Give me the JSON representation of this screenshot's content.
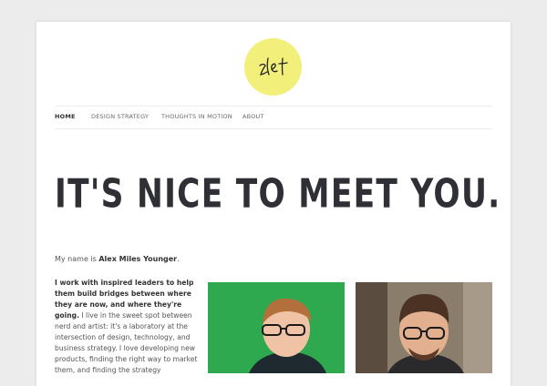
{
  "logo": {
    "text": "zle+",
    "color": "#f2f07a"
  },
  "nav": {
    "items": [
      {
        "label": "HOME",
        "active": true
      },
      {
        "label": "DESIGN STRATEGY",
        "active": false
      },
      {
        "label": "THOUGHTS IN MOTION",
        "active": false
      },
      {
        "label": "ABOUT",
        "active": false
      }
    ]
  },
  "hero": {
    "headline": "IT'S NICE TO MEET YOU."
  },
  "intro": {
    "prefix": "My name is ",
    "name": "Alex Miles Younger",
    "suffix": "."
  },
  "body": {
    "bold_text": "I work with inspired leaders to help them build bridges between where they are now, and where they're going.",
    "rest_text": " I live in the sweet spot between nerd and artist: it's a laboratory at the intersection of design, technology, and business strategy. I love developing new products, finding the right way to market them, and finding the strategy"
  },
  "photos": [
    {
      "alt": "portrait-green-background",
      "background": "#2fae53"
    },
    {
      "alt": "portrait-city-background",
      "background": "#7b6d5f"
    }
  ]
}
